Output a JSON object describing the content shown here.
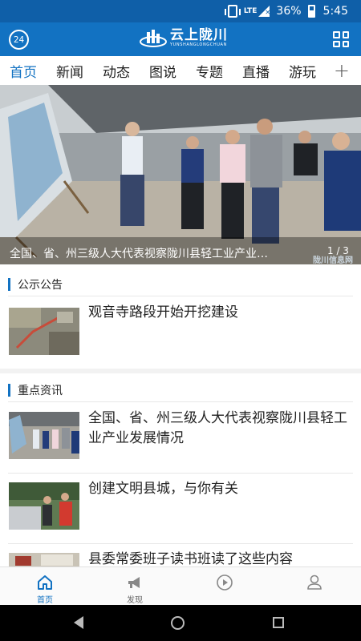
{
  "status_bar": {
    "network": "LTE",
    "battery": "36%",
    "time": "5:45"
  },
  "header": {
    "left_badge": "24",
    "logo_title": "云上陇川",
    "logo_subtitle": "YUNSHANGLONGCHUAN"
  },
  "tabs": [
    {
      "label": "首页",
      "active": true
    },
    {
      "label": "新闻",
      "active": false
    },
    {
      "label": "动态",
      "active": false
    },
    {
      "label": "图说",
      "active": false
    },
    {
      "label": "专题",
      "active": false
    },
    {
      "label": "直播",
      "active": false
    },
    {
      "label": "游玩",
      "active": false
    }
  ],
  "tab_more_icon": "plus-icon",
  "banner": {
    "caption": "全国、省、州三级人大代表视察陇川县轻工业产业…",
    "page_indicator": "1 / 3",
    "watermark": "陇川信息网"
  },
  "notice_section": {
    "title": "公示公告",
    "items": [
      {
        "title": "观音寺路段开始开挖建设"
      }
    ]
  },
  "key_news_section": {
    "title": "重点资讯",
    "items": [
      {
        "title": "全国、省、州三级人大代表视察陇川县轻工业产业发展情况"
      },
      {
        "title": "创建文明县城，与你有关"
      },
      {
        "title": "县委常委班子读书班读了这些内容"
      }
    ]
  },
  "bottom_nav": [
    {
      "label": "首页",
      "icon": "home-icon",
      "active": true
    },
    {
      "label": "发现",
      "icon": "megaphone-icon",
      "active": false
    },
    {
      "label": "",
      "icon": "play-icon",
      "active": false
    },
    {
      "label": "",
      "icon": "user-icon",
      "active": false
    }
  ],
  "colors": {
    "brand": "#1272c2",
    "status_bar": "#0f5fa8",
    "active_tab": "#1272c2"
  }
}
